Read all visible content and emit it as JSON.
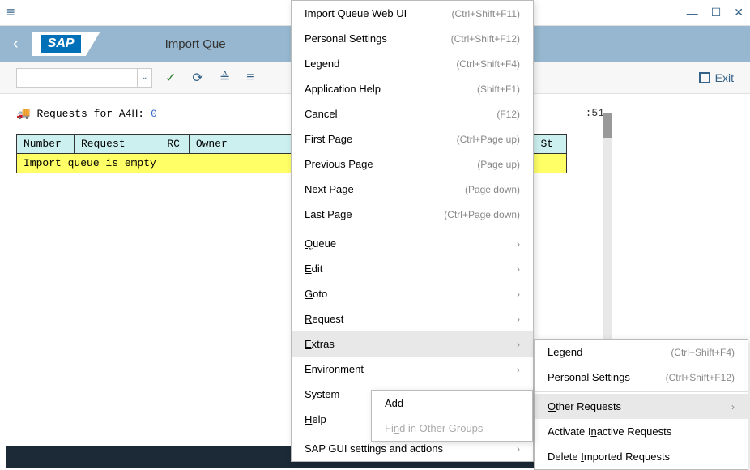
{
  "titlebar": {
    "minimize": "—",
    "maximize": "☐",
    "close": "✕"
  },
  "header": {
    "logo_text": "SAP",
    "title": "Import Que"
  },
  "toolbar": {
    "exit_label": "Exit"
  },
  "content": {
    "requests_prefix": "Requests for A4H:",
    "requests_count": "0",
    "timestamp": ":51",
    "headers": [
      "Number",
      "Request",
      "RC",
      "Owner",
      "St"
    ],
    "empty_msg": "Import queue is empty"
  },
  "menu": {
    "items": [
      {
        "label": "Import Queue Web UI",
        "shortcut": "(Ctrl+Shift+F11)"
      },
      {
        "label": "Personal Settings",
        "shortcut": "(Ctrl+Shift+F12)"
      },
      {
        "label": "Legend",
        "shortcut": "(Ctrl+Shift+F4)"
      },
      {
        "label": "Application Help",
        "shortcut": "(Shift+F1)"
      },
      {
        "label": "Cancel",
        "shortcut": "(F12)"
      },
      {
        "label": "First Page",
        "shortcut": "(Ctrl+Page up)"
      },
      {
        "label": "Previous Page",
        "shortcut": "(Page up)"
      },
      {
        "label": "Next Page",
        "shortcut": "(Page down)"
      },
      {
        "label": "Last Page",
        "shortcut": "(Ctrl+Page down)"
      }
    ],
    "sub_items": [
      {
        "label_html": "Queue",
        "ul": "Q"
      },
      {
        "label_html": "Edit",
        "ul": "E"
      },
      {
        "label_html": "Goto",
        "ul": "G"
      },
      {
        "label_html": "Request",
        "ul": "R"
      },
      {
        "label_html": "Extras",
        "ul": "E"
      },
      {
        "label_html": "Environment",
        "ul": "E"
      },
      {
        "label_html": "System",
        "ul": ""
      },
      {
        "label_html": "Help",
        "ul": "H"
      },
      {
        "label_html": "SAP GUI settings and actions",
        "ul": ""
      }
    ]
  },
  "submenu_extras": {
    "items": [
      {
        "label": "Legend",
        "shortcut": "(Ctrl+Shift+F4)"
      },
      {
        "label": "Personal Settings",
        "shortcut": "(Ctrl+Shift+F12)"
      }
    ],
    "sub_items": [
      {
        "label": "Other Requests",
        "ul": "O"
      },
      {
        "label": "Activate Inactive Requests",
        "ul": "n"
      },
      {
        "label": "Delete Imported Requests",
        "ul": "I"
      }
    ]
  },
  "subsub": {
    "add": "Add",
    "find": "Find in Other Groups",
    "add_ul": "A",
    "find_ul": "n"
  }
}
